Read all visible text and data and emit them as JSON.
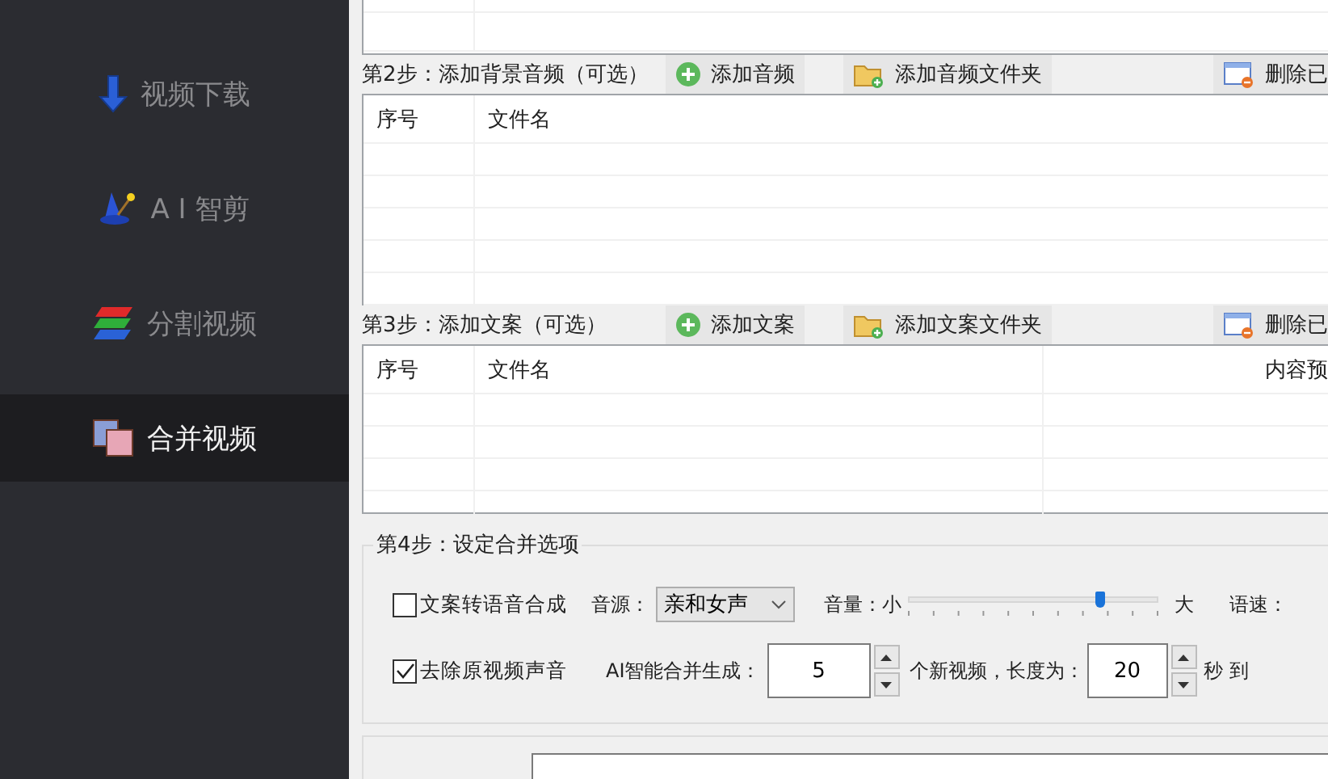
{
  "sidebar": {
    "items": [
      {
        "kind": "download",
        "label": "视频下载",
        "selected": false
      },
      {
        "kind": "wizard",
        "label": "A I 智剪",
        "selected": false
      },
      {
        "kind": "layers",
        "label": "分割视频",
        "selected": false
      },
      {
        "kind": "merge",
        "label": "合并视频",
        "selected": true
      }
    ]
  },
  "steps": [
    {
      "label": "第2步：添加背景音频（可选）",
      "buttons": [
        {
          "kind": "add",
          "label": "添加音频"
        },
        {
          "kind": "folder",
          "label": "添加音频文件夹"
        },
        {
          "kind": "delete",
          "label": "删除已"
        }
      ],
      "columns": [
        "序号",
        "文件名"
      ]
    },
    {
      "label": "第3步：添加文案（可选）",
      "buttons": [
        {
          "kind": "add",
          "label": "添加文案"
        },
        {
          "kind": "folder",
          "label": "添加文案文件夹"
        },
        {
          "kind": "delete",
          "label": "删除已"
        }
      ],
      "columns": [
        "序号",
        "文件名",
        "内容预"
      ]
    }
  ],
  "options": {
    "title": "第4步：设定合并选项",
    "tts": {
      "label": "文案转语音合成",
      "checked": false
    },
    "voice_label": "音源：",
    "voice": "亲和女声",
    "volume_label": "音量：",
    "volume_min": "小",
    "volume": {
      "level": 0.77
    },
    "volume_max": "大",
    "speed_label": "语速：",
    "mute": {
      "label": "去除原视频声音",
      "checked": true
    },
    "count_label": "AI智能合并生成：",
    "count": "5",
    "count_suffix": "个新视频，长度为：",
    "length": "20",
    "unit": "秒",
    "to": "到"
  }
}
